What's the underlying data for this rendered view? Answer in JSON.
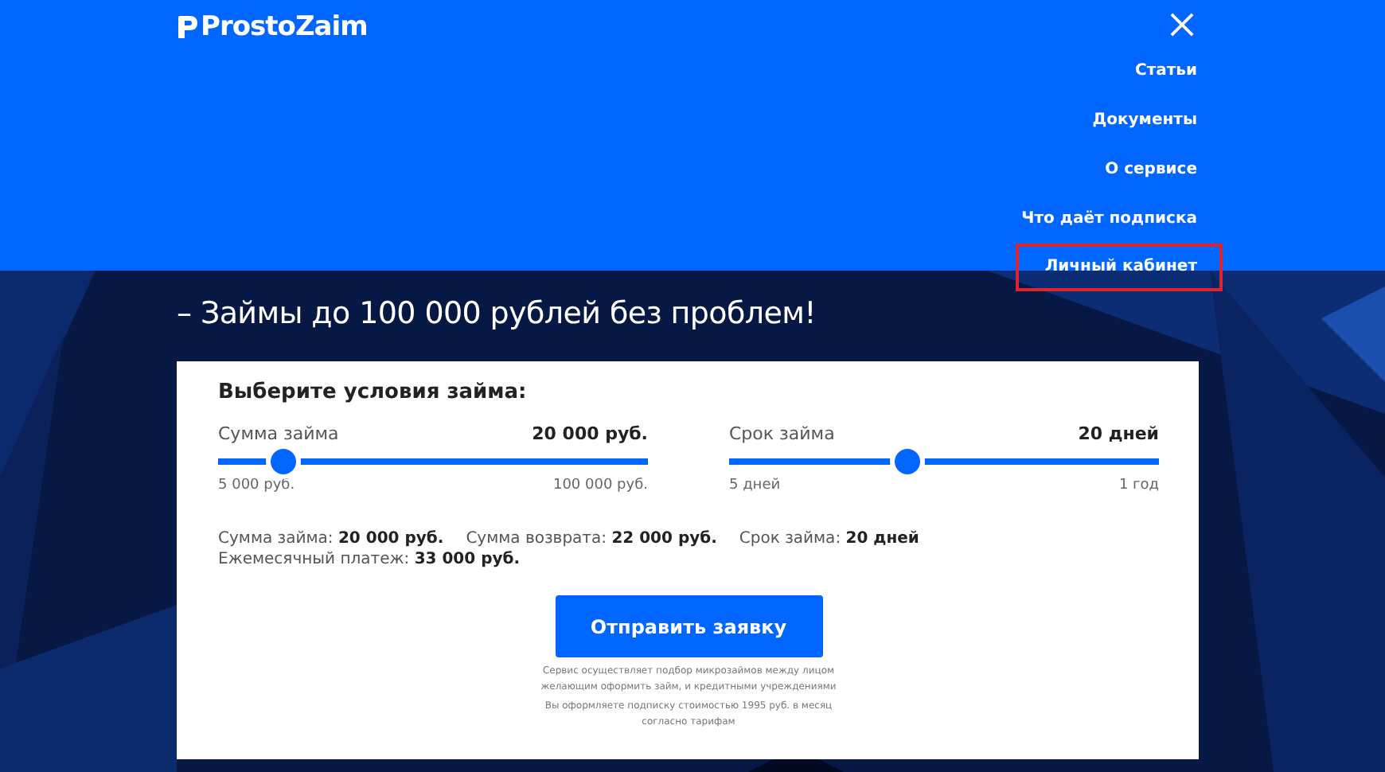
{
  "header": {
    "logo": "ProstoZaim",
    "menu": [
      {
        "label": "Статьи",
        "highlighted": false
      },
      {
        "label": "Документы",
        "highlighted": false
      },
      {
        "label": "О сервисе",
        "highlighted": false
      },
      {
        "label": "Что даёт подписка",
        "highlighted": false
      },
      {
        "label": "Личный кабинет",
        "highlighted": true
      }
    ]
  },
  "hero": {
    "lines": [
      "– Займы до 100 000 рублей без проблем!"
    ]
  },
  "calculator": {
    "title": "Выберите условия займа:",
    "sliders": [
      {
        "label": "Сумма займа",
        "value": "20 000 руб.",
        "level": 0.15,
        "min": "5 000 руб.",
        "max": "100 000 руб."
      },
      {
        "label": "Срок займа",
        "value": "20 дней",
        "level": 0.415,
        "min": "5 дней",
        "max": "1 год"
      }
    ],
    "summary": [
      "Сумма займа: **20 000 руб.**",
      "Сумма возврата: **22 000 руб.**",
      "Срок займа: **20 дней**",
      "Ежемесячный платеж: **33 000 руб.**"
    ],
    "submit": "Отправить заявку",
    "notes": [
      "Сервис осуществляет подбор микрозаймов между лицом желающим оформить займ, и кредитными учреждениями",
      "Вы оформляете подписку стоимостью 1995 руб. в месяц согласно тарифам"
    ]
  }
}
